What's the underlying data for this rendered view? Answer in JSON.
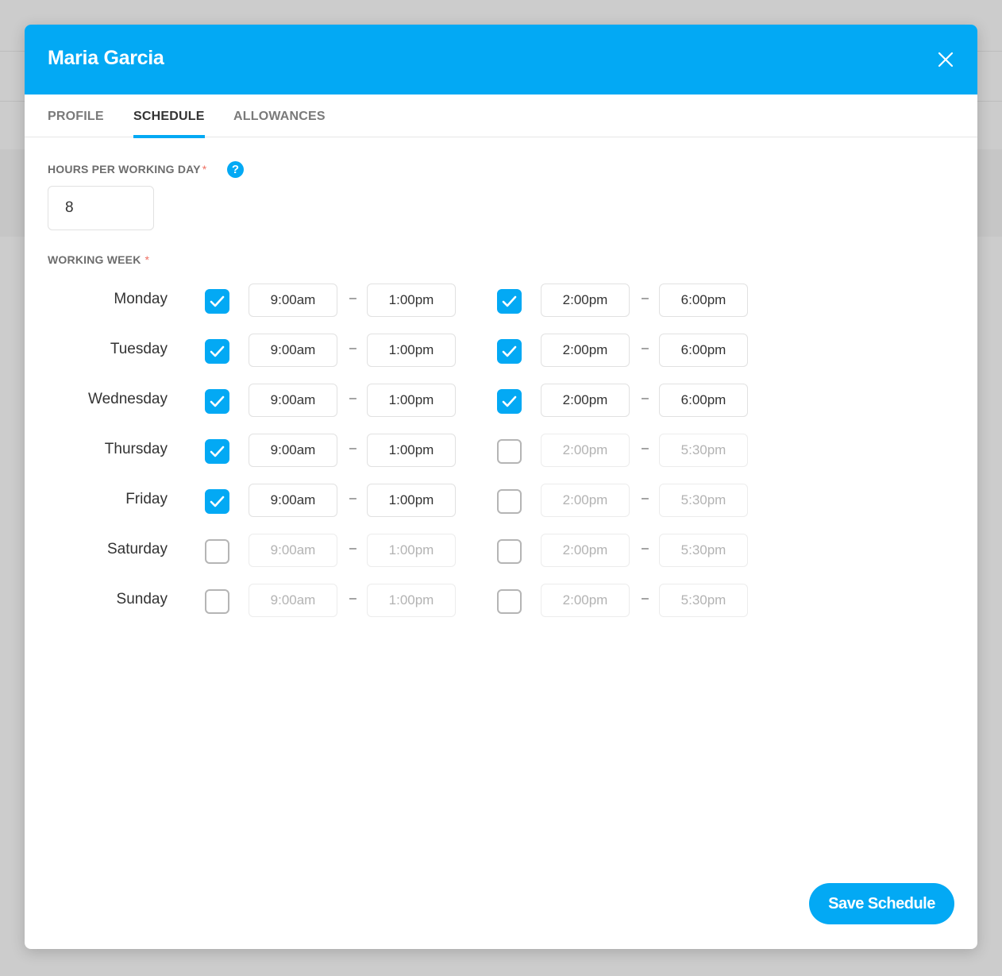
{
  "modal": {
    "title": "Maria Garcia",
    "colors": {
      "accent": "#03a9f4",
      "required": "#ef6f62"
    }
  },
  "tabs": [
    {
      "label": "PROFILE",
      "active": false
    },
    {
      "label": "SCHEDULE",
      "active": true
    },
    {
      "label": "ALLOWANCES",
      "active": false
    }
  ],
  "hours": {
    "label": "HOURS PER WORKING DAY",
    "required_mark": "*",
    "help_icon": "?",
    "value": "8"
  },
  "week": {
    "label": "WORKING WEEK",
    "required_mark": "*",
    "separator": "–",
    "days": [
      {
        "name": "Monday",
        "s1": {
          "checked": true,
          "start": "9:00am",
          "end": "1:00pm"
        },
        "s2": {
          "checked": true,
          "start": "2:00pm",
          "end": "6:00pm"
        }
      },
      {
        "name": "Tuesday",
        "s1": {
          "checked": true,
          "start": "9:00am",
          "end": "1:00pm"
        },
        "s2": {
          "checked": true,
          "start": "2:00pm",
          "end": "6:00pm"
        }
      },
      {
        "name": "Wednesday",
        "s1": {
          "checked": true,
          "start": "9:00am",
          "end": "1:00pm"
        },
        "s2": {
          "checked": true,
          "start": "2:00pm",
          "end": "6:00pm"
        }
      },
      {
        "name": "Thursday",
        "s1": {
          "checked": true,
          "start": "9:00am",
          "end": "1:00pm"
        },
        "s2": {
          "checked": false,
          "start": "2:00pm",
          "end": "5:30pm"
        }
      },
      {
        "name": "Friday",
        "s1": {
          "checked": true,
          "start": "9:00am",
          "end": "1:00pm"
        },
        "s2": {
          "checked": false,
          "start": "2:00pm",
          "end": "5:30pm"
        }
      },
      {
        "name": "Saturday",
        "s1": {
          "checked": false,
          "start": "9:00am",
          "end": "1:00pm"
        },
        "s2": {
          "checked": false,
          "start": "2:00pm",
          "end": "5:30pm"
        }
      },
      {
        "name": "Sunday",
        "s1": {
          "checked": false,
          "start": "9:00am",
          "end": "1:00pm"
        },
        "s2": {
          "checked": false,
          "start": "2:00pm",
          "end": "5:30pm"
        }
      }
    ]
  },
  "footer": {
    "save_label": "Save Schedule"
  }
}
